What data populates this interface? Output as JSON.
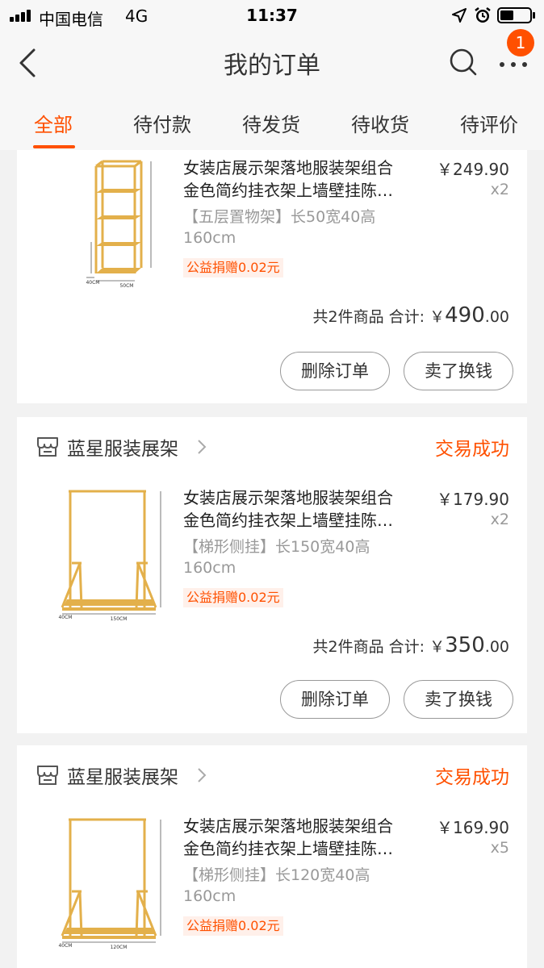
{
  "status_bar": {
    "carrier": "中国电信",
    "network": "4G",
    "time": "11:37"
  },
  "header": {
    "title": "我的订单",
    "badge_count": "1"
  },
  "tabs": [
    {
      "label": "全部",
      "active": true
    },
    {
      "label": "待付款",
      "active": false
    },
    {
      "label": "待发货",
      "active": false
    },
    {
      "label": "待收货",
      "active": false
    },
    {
      "label": "待评价",
      "active": false
    }
  ],
  "orders": [
    {
      "shop_name": "",
      "status": "",
      "item": {
        "title_line1": "女装店展示架落地服装架组合",
        "title_line2": "金色简约挂衣架上墙壁挂陈…",
        "sku": "【五层置物架】长50宽40高160cm",
        "charity": "公益捐赠0.02元",
        "price": "￥249.90",
        "qty": "x2"
      },
      "summary": {
        "count": "共2件商品",
        "label": "合计:",
        "currency": "￥",
        "int": "490",
        "dec": ".00"
      },
      "buttons": {
        "delete": "删除订单",
        "resell": "卖了换钱"
      }
    },
    {
      "shop_name": "蓝星服装展架",
      "status": "交易成功",
      "item": {
        "title_line1": "女装店展示架落地服装架组合",
        "title_line2": "金色简约挂衣架上墙壁挂陈…",
        "sku": "【梯形侧挂】长150宽40高160cm",
        "charity": "公益捐赠0.02元",
        "price": "￥179.90",
        "qty": "x2"
      },
      "summary": {
        "count": "共2件商品",
        "label": "合计:",
        "currency": "￥",
        "int": "350",
        "dec": ".00"
      },
      "buttons": {
        "delete": "删除订单",
        "resell": "卖了换钱"
      }
    },
    {
      "shop_name": "蓝星服装展架",
      "status": "交易成功",
      "item": {
        "title_line1": "女装店展示架落地服装架组合",
        "title_line2": "金色简约挂衣架上墙壁挂陈…",
        "sku": "【梯形侧挂】长120宽40高160cm",
        "charity": "公益捐赠0.02元",
        "price": "￥169.90",
        "qty": "x5"
      }
    }
  ],
  "thumb_dims": {
    "shelf": {
      "w": "50CM",
      "d": "40CM"
    },
    "rack150": {
      "w": "150CM",
      "d": "40CM"
    },
    "rack120": {
      "w": "120CM",
      "d": "40CM"
    }
  },
  "colors": {
    "accent": "#ff5000",
    "gold": "#e3b04b"
  }
}
